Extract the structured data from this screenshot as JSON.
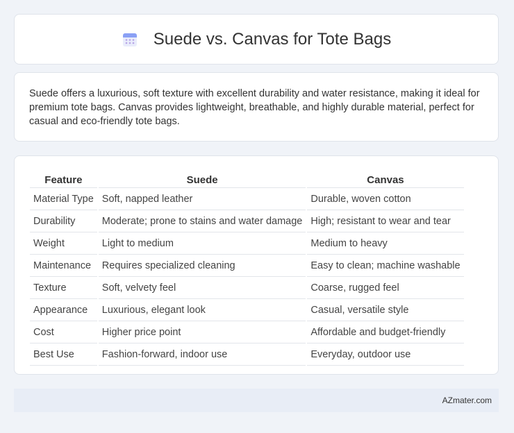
{
  "header": {
    "title": "Suede vs. Canvas for Tote Bags",
    "icon": "calendar-icon"
  },
  "intro": {
    "text": "Suede offers a luxurious, soft texture with excellent durability and water resistance, making it ideal for premium tote bags. Canvas provides lightweight, breathable, and highly durable material, perfect for casual and eco-friendly tote bags."
  },
  "table": {
    "headers": [
      "Feature",
      "Suede",
      "Canvas"
    ],
    "rows": [
      [
        "Material Type",
        "Soft, napped leather",
        "Durable, woven cotton"
      ],
      [
        "Durability",
        "Moderate; prone to stains and water damage",
        "High; resistant to wear and tear"
      ],
      [
        "Weight",
        "Light to medium",
        "Medium to heavy"
      ],
      [
        "Maintenance",
        "Requires specialized cleaning",
        "Easy to clean; machine washable"
      ],
      [
        "Texture",
        "Soft, velvety feel",
        "Coarse, rugged feel"
      ],
      [
        "Appearance",
        "Luxurious, elegant look",
        "Casual, versatile style"
      ],
      [
        "Cost",
        "Higher price point",
        "Affordable and budget-friendly"
      ],
      [
        "Best Use",
        "Fashion-forward, indoor use",
        "Everyday, outdoor use"
      ]
    ]
  },
  "footer": {
    "site": "AZmater.com"
  },
  "colors": {
    "background": "#f0f3f8",
    "card": "#ffffff",
    "footer_bg": "#e8edf6",
    "icon_accent": "#7b8ff0"
  }
}
